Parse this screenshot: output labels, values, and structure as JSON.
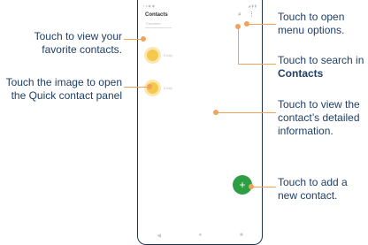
{
  "callouts": {
    "menu": [
      "Touch to open",
      "menu options."
    ],
    "search_prefix": "Touch to search in",
    "search_bold": "Contacts",
    "favorites": [
      "Touch to view your",
      "favorite contacts."
    ],
    "quick": [
      "Touch the image to open",
      "the Quick contact panel"
    ],
    "details": [
      "Touch to view the",
      "contact’s detailed",
      "information."
    ],
    "add": [
      "Touch to add a",
      "new contact."
    ]
  },
  "phone": {
    "app_title": "Contacts",
    "favorites_label": "Favorites",
    "contacts": [
      {
        "initial": "",
        "name": "Emily"
      },
      {
        "initial": "",
        "name": "Emily"
      }
    ],
    "fab_label": "+"
  },
  "icons": [
    "more-options-icon",
    "search-icon",
    "back-icon",
    "home-icon",
    "recents-icon"
  ],
  "colors": {
    "callout_text": "#1f3f66",
    "leader_line": "#f0a35b",
    "fab": "#2e9e45",
    "avatar": "#f4c94e"
  }
}
